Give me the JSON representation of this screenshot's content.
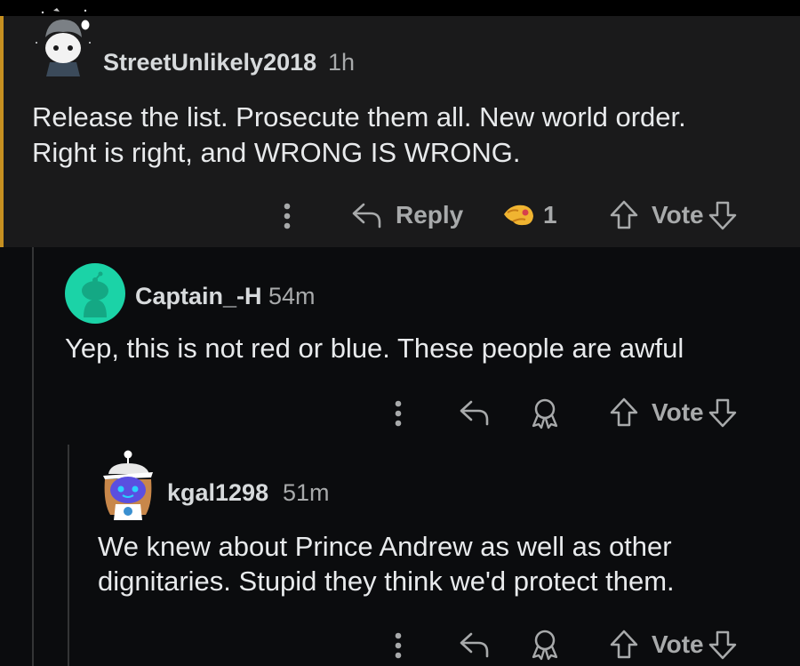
{
  "comments": [
    {
      "author": "StreetUnlikely2018",
      "time": "1h",
      "lines": [
        "Release the list. Prosecute them all. New world order.",
        "Right is right, and WRONG IS WRONG."
      ],
      "actions": {
        "reply_label": "Reply",
        "award_count": "1",
        "vote_label": "Vote"
      }
    },
    {
      "author": "Captain_-H",
      "time": "54m",
      "lines": [
        "Yep, this is not red or blue. These people are awful"
      ],
      "actions": {
        "vote_label": "Vote"
      }
    },
    {
      "author": "kgal1298",
      "time": "51m",
      "lines": [
        "We knew about Prince Andrew as well as other",
        "dignitaries. Stupid they think we'd protect them."
      ],
      "actions": {
        "vote_label": "Vote"
      }
    }
  ],
  "colors": {
    "background": "#0b0c0e",
    "highlight_background": "#1a1a1b",
    "highlight_accent": "#c69021",
    "text": "#e8eaec",
    "meta": "#a8aaab",
    "avatar_teal": "#1bd3a7"
  }
}
